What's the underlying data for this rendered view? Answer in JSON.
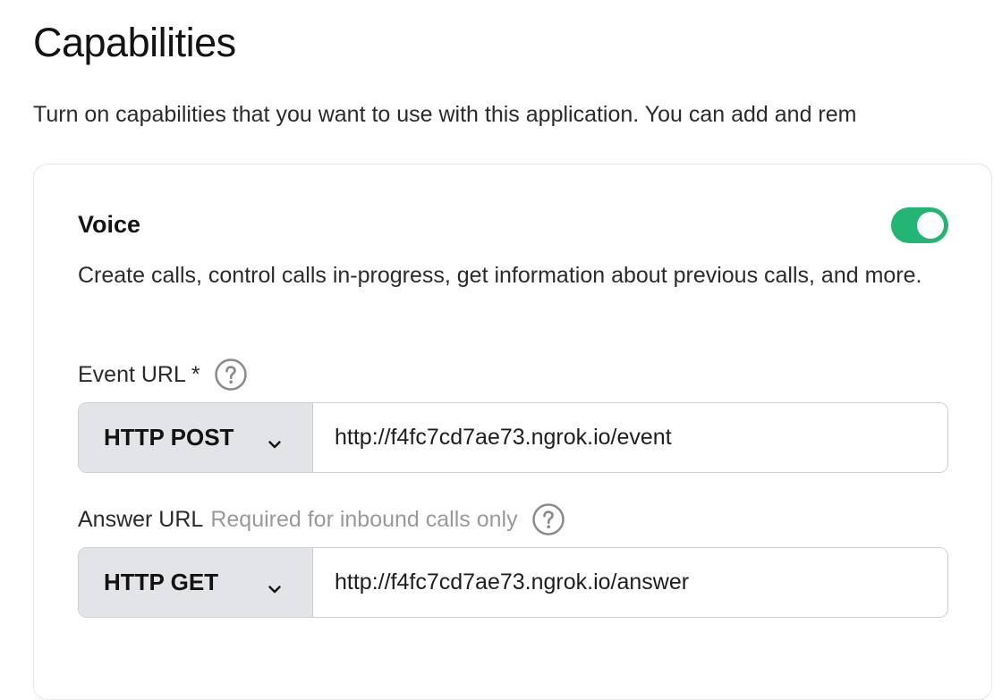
{
  "page": {
    "title": "Capabilities",
    "description": "Turn on capabilities that you want to use with this application. You can add and rem"
  },
  "voice": {
    "title": "Voice",
    "enabled": true,
    "description": "Create calls, control calls in-progress, get information about previous calls, and more.",
    "event_url": {
      "label": "Event URL *",
      "method": "HTTP POST",
      "value": "http://f4fc7cd7ae73.ngrok.io/event",
      "help_icon": "question-circle-icon"
    },
    "answer_url": {
      "label": "Answer URL",
      "hint": "Required for inbound calls only",
      "method": "HTTP GET",
      "value": "http://f4fc7cd7ae73.ngrok.io/answer",
      "help_icon": "question-circle-icon"
    }
  },
  "colors": {
    "toggle_on": "#22b573",
    "method_bg": "#e3e4e7",
    "hint_text": "#9a9a9a"
  }
}
